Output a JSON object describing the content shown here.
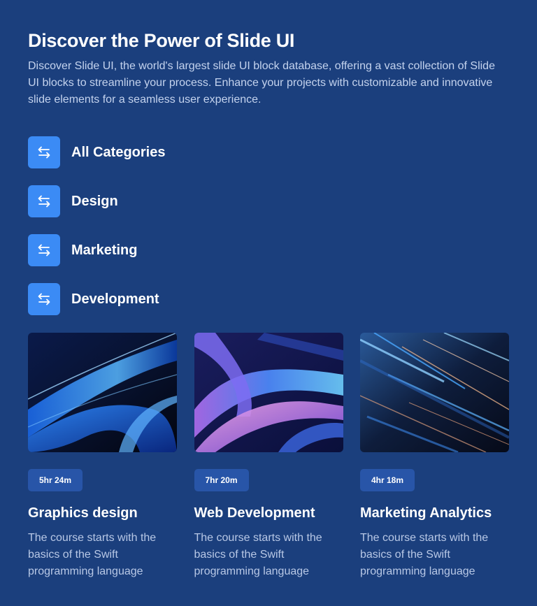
{
  "header": {
    "title": "Discover the Power of Slide UI",
    "description": "Discover Slide UI, the world's largest slide UI block database, offering a vast collection of Slide UI blocks to streamline your process. Enhance your projects with customizable and innovative slide elements for a seamless user experience."
  },
  "categories": [
    {
      "label": "All Categories",
      "icon": "swap-arrows-icon"
    },
    {
      "label": "Design",
      "icon": "swap-arrows-icon"
    },
    {
      "label": "Marketing",
      "icon": "swap-arrows-icon"
    },
    {
      "label": "Development",
      "icon": "swap-arrows-icon"
    }
  ],
  "courses": [
    {
      "duration": "5hr 24m",
      "title": "Graphics design",
      "description": "The course starts with the basics of the Swift programming language",
      "image": "abstract-blue-waves"
    },
    {
      "duration": "7hr 20m",
      "title": "Web Development",
      "description": "The course starts with the basics of the Swift programming language",
      "image": "abstract-purple-ribbons"
    },
    {
      "duration": "4hr 18m",
      "title": "Marketing Analytics",
      "description": "The course starts with the basics of the Swift programming language",
      "image": "abstract-light-streaks"
    }
  ],
  "colors": {
    "background": "#1b3f7d",
    "icon_tile": "#3b8bf5",
    "badge": "#2855a8",
    "muted_text": "#c4d3ee"
  }
}
